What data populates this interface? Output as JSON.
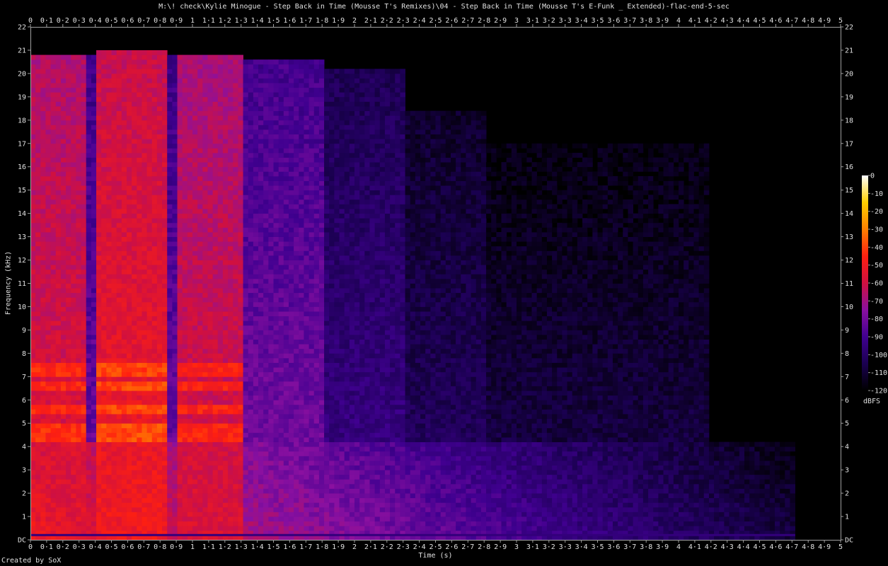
{
  "chart_data": {
    "type": "heatmap",
    "title": "M:\\! check\\Kylie Minogue - Step Back in Time (Mousse T's Remixes)\\04 - Step Back in Time (Mousse T's E-Funk _ Extended)-flac-end-5-sec",
    "xlabel": "Time (s)",
    "ylabel": "Frequency (kHz)",
    "colorbar_label": "dBFS",
    "footer": "Created by SoX",
    "xlim": [
      0,
      5
    ],
    "ylim": [
      0,
      22
    ],
    "x_ticks": [
      "0",
      "0·1",
      "0·2",
      "0·3",
      "0·4",
      "0·5",
      "0·6",
      "0·7",
      "0·8",
      "0·9",
      "1",
      "1·1",
      "1·2",
      "1·3",
      "1·4",
      "1·5",
      "1·6",
      "1·7",
      "1·8",
      "1·9",
      "2",
      "2·1",
      "2·2",
      "2·3",
      "2·4",
      "2·5",
      "2·6",
      "2·7",
      "2·8",
      "2·9",
      "3",
      "3·1",
      "3·2",
      "3·3",
      "3·4",
      "3·5",
      "3·6",
      "3·7",
      "3·8",
      "3·9",
      "4",
      "4·1",
      "4·2",
      "4·3",
      "4·4",
      "4·5",
      "4·6",
      "4·7",
      "4·8",
      "4·9",
      "5"
    ],
    "y_ticks": [
      "DC",
      "1",
      "2",
      "3",
      "4",
      "5",
      "6",
      "7",
      "8",
      "9",
      "10",
      "11",
      "12",
      "13",
      "14",
      "15",
      "16",
      "17",
      "18",
      "19",
      "20",
      "21",
      "22"
    ],
    "colorbar_ticks": [
      "0",
      "-10",
      "-20",
      "-30",
      "-40",
      "-50",
      "-60",
      "-70",
      "-80",
      "-90",
      "-100",
      "-110",
      "-120"
    ],
    "colorbar_range": [
      -120,
      0
    ],
    "colormap_stops": [
      "#000000",
      "#1a0050",
      "#400090",
      "#8a10a0",
      "#d01040",
      "#ff2010",
      "#ff8000",
      "#ffd000",
      "#ffffff"
    ],
    "segments": [
      {
        "t0": 0.0,
        "t1": 0.34,
        "upper_khz": 20.8,
        "level_db": -55
      },
      {
        "t0": 0.34,
        "t1": 0.42,
        "upper_khz": 20.8,
        "level_db": -80
      },
      {
        "t0": 0.42,
        "t1": 0.84,
        "upper_khz": 21.0,
        "level_db": -50
      },
      {
        "t0": 0.84,
        "t1": 0.9,
        "upper_khz": 20.8,
        "level_db": -80
      },
      {
        "t0": 0.9,
        "t1": 1.32,
        "upper_khz": 20.9,
        "level_db": -57
      },
      {
        "t0": 1.32,
        "t1": 1.82,
        "upper_khz": 20.6,
        "level_db": -78
      },
      {
        "t0": 1.82,
        "t1": 2.32,
        "upper_khz": 20.3,
        "level_db": -92
      },
      {
        "t0": 2.32,
        "t1": 2.8,
        "upper_khz": 18.5,
        "level_db": -100
      },
      {
        "t0": 2.8,
        "t1": 4.2,
        "upper_khz": 17.0,
        "level_db": -105
      },
      {
        "t0": 4.2,
        "t1": 5.0,
        "upper_khz": 0.0,
        "level_db": -120
      }
    ],
    "low_band": {
      "upper_khz": 4.2,
      "t_end": 4.72,
      "level_db_start": -50,
      "level_db_end": -108
    },
    "bright_band_khz": [
      4.4,
      4.8,
      5.6,
      6.6,
      7.2,
      7.5
    ]
  }
}
